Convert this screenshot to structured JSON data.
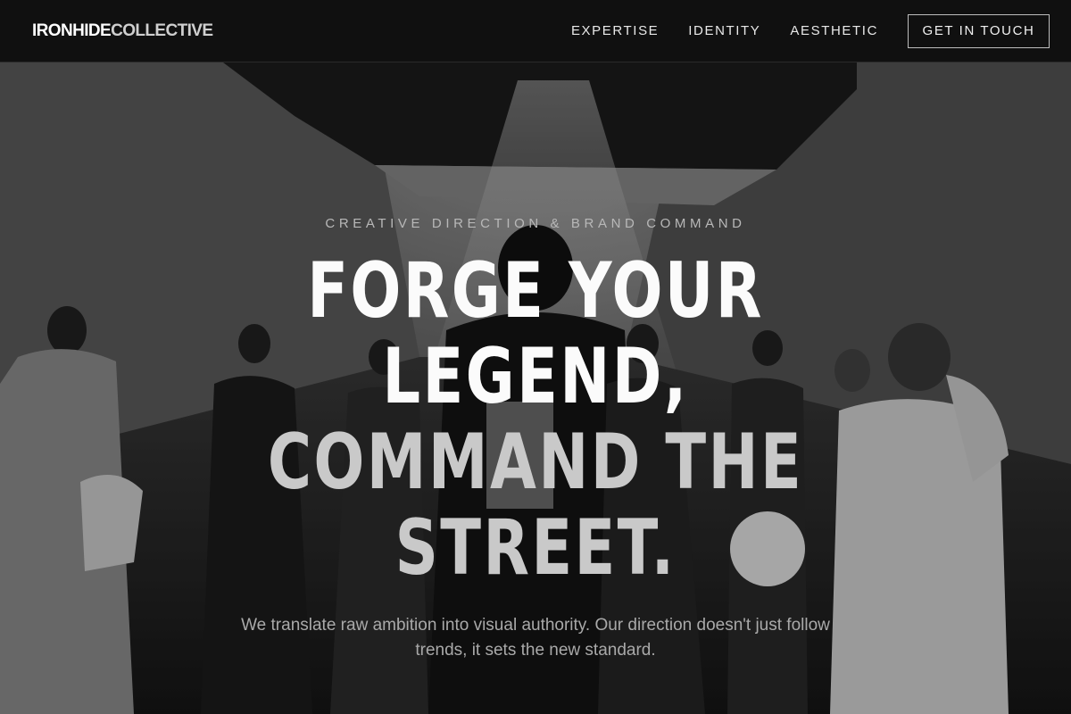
{
  "brand": {
    "part1": "IRONHIDE",
    "part2": "COLLECTIVE"
  },
  "nav": {
    "items": [
      {
        "label": "EXPERTISE"
      },
      {
        "label": "IDENTITY"
      },
      {
        "label": "AESTHETIC"
      }
    ],
    "cta_label": "GET IN TOUCH"
  },
  "hero": {
    "eyebrow": "CREATIVE DIRECTION & BRAND COMMAND",
    "headline": {
      "line1": "FORGE YOUR",
      "line2": "LEGEND,",
      "line3": "COMMAND THE",
      "line4": "STREET."
    },
    "subtext": "We translate raw ambition into visual authority. Our direction doesn't just follow trends, it sets the new standard."
  },
  "colors": {
    "nav_bg": "#101010",
    "headline_primary": "#fbfbfb",
    "headline_secondary": "#c9c9c9",
    "body_text": "#a9a9a9"
  }
}
